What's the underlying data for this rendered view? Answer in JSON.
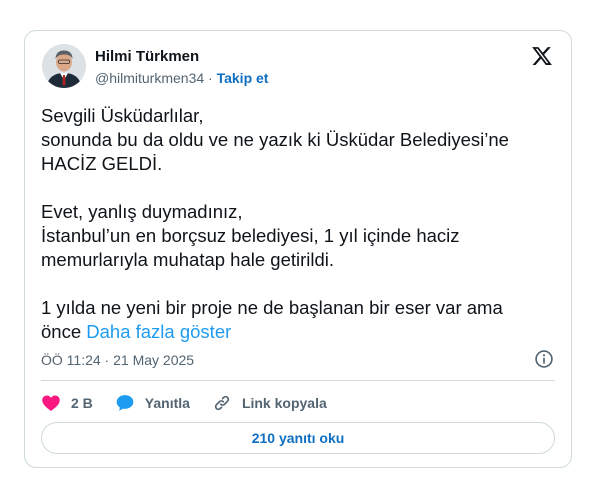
{
  "author": {
    "name": "Hilmi Türkmen",
    "handle": "@hilmiturkmen34",
    "separator": "·",
    "follow_label": "Takip et"
  },
  "tweet": {
    "lines": [
      "Sevgili Üsküdarlılar,",
      "sonunda bu da oldu ve ne yazık ki Üsküdar Belediyesi’ne",
      "HACİZ GELDİ.",
      "Evet, yanlış duymadınız,",
      "İstanbul’un en borçsuz belediyesi, 1 yıl içinde haciz",
      "memurlarıyla muhatap hale getirildi.",
      "1 yılda ne yeni bir proje ne de başlanan bir eser var ama",
      "önce"
    ],
    "show_more": "Daha fazla göster",
    "timestamp": "ÖÖ 11:24 · 21 May 2025"
  },
  "actions": {
    "like_count": "2 B",
    "reply_label": "Yanıtla",
    "copy_link_label": "Link kopyala"
  },
  "read_replies_label": "210 yanıtı oku",
  "icons": {
    "like": "heart-icon",
    "reply": "speech-bubble-icon",
    "copy_link": "link-icon",
    "info": "info-icon",
    "brand": "x-logo-icon"
  },
  "colors": {
    "like": "#f91880",
    "reply": "#1d9bf0",
    "link": "#1d9bf0",
    "accent_text": "#0f6fc2",
    "border": "#cfd9de",
    "muted": "#536471"
  }
}
